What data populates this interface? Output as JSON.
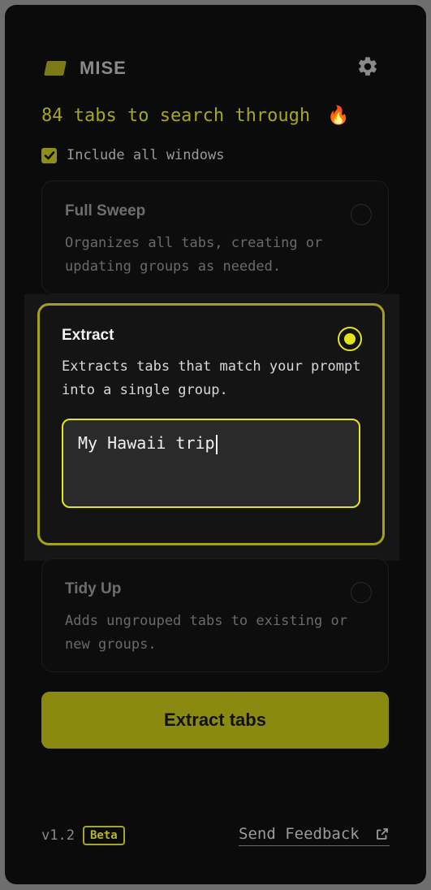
{
  "app": {
    "brand": "MISE",
    "logo_icon": "mise-logo-icon",
    "settings_icon": "gear-icon",
    "accent_color": "#e4e41a",
    "cta_color": "#8b8a10"
  },
  "status": {
    "tabs_count_text": "84 tabs to search through",
    "emoji": "🔥"
  },
  "include_all_windows": {
    "label": "Include all windows",
    "checked": true
  },
  "options": [
    {
      "title": "Full Sweep",
      "description": "Organizes all tabs, creating or updating groups as needed.",
      "selected": false
    },
    {
      "title": "Extract",
      "description": "Extracts tabs that match your prompt into a single group.",
      "selected": true,
      "prompt_value": "My Hawaii trip"
    },
    {
      "title": "Tidy Up",
      "description": "Adds ungrouped tabs to existing or new groups.",
      "selected": false
    }
  ],
  "primary_button": {
    "label": "Extract tabs"
  },
  "footer": {
    "version": "v1.2",
    "badge": "Beta",
    "feedback_label": "Send Feedback",
    "feedback_icon": "external-link-icon"
  }
}
